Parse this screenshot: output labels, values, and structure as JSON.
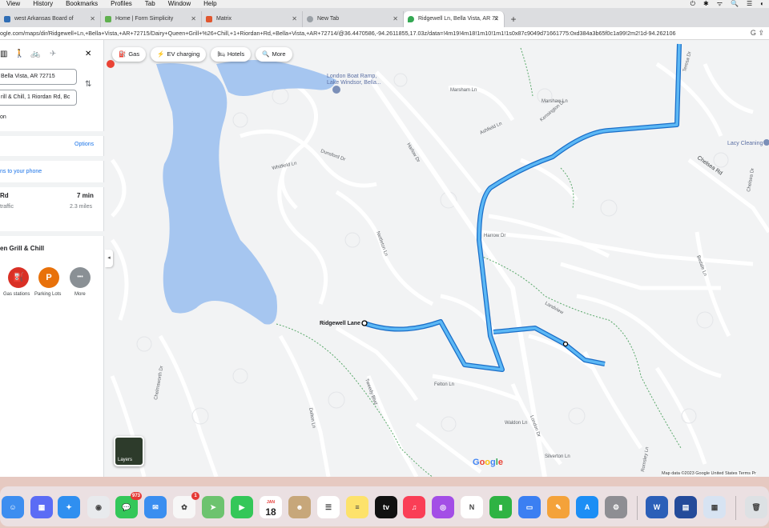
{
  "menubar": {
    "items": [
      "View",
      "History",
      "Bookmarks",
      "Profiles",
      "Tab",
      "Window",
      "Help"
    ],
    "status": [
      "⏻",
      "✱",
      "ᯤ",
      "🔍",
      "☰",
      "◐"
    ]
  },
  "tabs": [
    {
      "title": "west Arkansas Board of",
      "color": "#2f6db5"
    },
    {
      "title": "Home | Form Simplicity",
      "color": "#5fb04f"
    },
    {
      "title": "Matrix",
      "color": "#e0562f"
    },
    {
      "title": "New Tab",
      "color": "#9aa0a6"
    },
    {
      "title": "Ridgewell Ln, Bella Vista, AR 72",
      "color": "#34a853"
    }
  ],
  "address": {
    "url": "ogle.com/maps/dir/Ridgewell+Ln,+Bella+Vista,+AR+72715/Dairy+Queen+Grill+%26+Chill,+1+Riordan+Rd,+Bella+Vista,+AR+72714/@36.4470586,-94.2611855,17.03z/data=!4m19!4m18!1m10!1m1!1s0x87c9049d71661775:0xd384a3b65f0c1a99!2m2!1d-94.262106"
  },
  "sidebar": {
    "origin": "Bella Vista, AR 72715",
    "destination": "rill & Chill, 1 Riordan Rd, Bc",
    "add_destination": "on",
    "options": "Options",
    "send_to_phone": "ns to your phone",
    "route": {
      "name": "Rd",
      "time": "7 min",
      "traffic": "traffic",
      "distance": "2.3 miles"
    },
    "nearby_title": "en Grill & Chill",
    "nearby": [
      {
        "label": "Gas stations",
        "icon": "gas-icon",
        "glyph": "⛽",
        "color": "#d93025"
      },
      {
        "label": "Parking Lots",
        "icon": "parking-icon",
        "glyph": "P",
        "color": "#e8710a"
      },
      {
        "label": "More",
        "icon": "more-icon",
        "glyph": "•••",
        "color": "#8a9095"
      }
    ]
  },
  "chips": [
    {
      "label": "Gas",
      "glyph": "⛽"
    },
    {
      "label": "EV charging",
      "glyph": "⚡"
    },
    {
      "label": "Hotels",
      "glyph": "🛏"
    },
    {
      "label": "More",
      "glyph": "🔍"
    }
  ],
  "map": {
    "place_labels": {
      "boat_ramp": "London Boat Ramp,",
      "boat_ramp2": "Lake Windsor, Bella...",
      "ridgewell": "Ridgewell Lane",
      "lacy": "Lacy Cleaning"
    },
    "streets": [
      "Marsham Ln",
      "Ashfield Ln",
      "Marshaw Ln",
      "Kensington Dr",
      "Harlow Dr",
      "Dunsford Dr",
      "Whitfield Ln",
      "Chelsea Rd",
      "Nettleton Ln",
      "Harrow Dr",
      "Felton Ln",
      "Waldon Ln",
      "London Dr",
      "Silverton Ln",
      "Tweedy Blvd",
      "Chelmsworth Dr",
      "Dolton Ln",
      "Landview",
      "Bedale Ln",
      "Teresa Dr",
      "Chelsea Dr",
      "Romsley Ln"
    ],
    "layers": "Layers",
    "google": "Google",
    "attribution": "Map data ©2023 Google   United States   Terms   Pr"
  },
  "dock": {
    "messages_badge": "973",
    "photos_badge": "1",
    "calendar_month": "JAN",
    "calendar_day": "18",
    "apps": [
      {
        "name": "finder-icon",
        "color": "#3d8ef0",
        "glyph": "☺"
      },
      {
        "name": "launchpad-icon",
        "color": "#5b6cf5",
        "glyph": "▦"
      },
      {
        "name": "safari-icon",
        "color": "#2f8ff0",
        "glyph": "✦"
      },
      {
        "name": "chrome-icon",
        "color": "#e8eaed",
        "glyph": "◉"
      },
      {
        "name": "messages-icon",
        "color": "#34c759",
        "glyph": "💬"
      },
      {
        "name": "mail-icon",
        "color": "#3a8ef0",
        "glyph": "✉"
      },
      {
        "name": "photos-icon",
        "color": "#f7f7f7",
        "glyph": "✿"
      },
      {
        "name": "maps-icon",
        "color": "#6dc36f",
        "glyph": "➤"
      },
      {
        "name": "facetime-icon",
        "color": "#34c759",
        "glyph": "▶"
      },
      {
        "name": "calendar-icon",
        "color": "#ffffff",
        "glyph": ""
      },
      {
        "name": "contacts-icon",
        "color": "#c7a77a",
        "glyph": "☻"
      },
      {
        "name": "reminders-icon",
        "color": "#ffffff",
        "glyph": "☰"
      },
      {
        "name": "notes-icon",
        "color": "#fde26b",
        "glyph": "≡"
      },
      {
        "name": "appletv-icon",
        "color": "#111111",
        "glyph": "tv"
      },
      {
        "name": "music-icon",
        "color": "#fa3e56",
        "glyph": "♫"
      },
      {
        "name": "podcasts-icon",
        "color": "#a34ee6",
        "glyph": "◎"
      },
      {
        "name": "news-icon",
        "color": "#ffffff",
        "glyph": "N"
      },
      {
        "name": "numbers-icon",
        "color": "#2fb344",
        "glyph": "▮"
      },
      {
        "name": "keynote-icon",
        "color": "#3b7ff2",
        "glyph": "▭"
      },
      {
        "name": "pages-icon",
        "color": "#f4a23a",
        "glyph": "✎"
      },
      {
        "name": "appstore-icon",
        "color": "#1c8ef5",
        "glyph": "A"
      },
      {
        "name": "settings-icon",
        "color": "#8e8e93",
        "glyph": "⚙"
      },
      {
        "name": "word-icon",
        "color": "#2b5fb8",
        "glyph": "W"
      },
      {
        "name": "scanner-icon",
        "color": "#244b9a",
        "glyph": "▤"
      },
      {
        "name": "preview-icon",
        "color": "#d7e3f2",
        "glyph": "▦"
      },
      {
        "name": "trash-icon",
        "color": "#dde1e4",
        "glyph": "🗑"
      }
    ]
  }
}
